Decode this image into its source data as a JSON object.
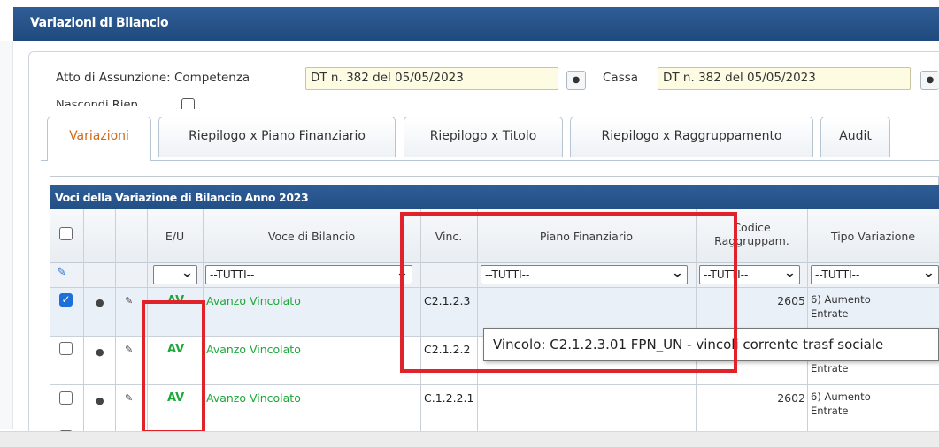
{
  "window": {
    "title": "Variazioni di Bilancio"
  },
  "header": {
    "atto_label": "Atto di Assunzione: Competenza",
    "competenza_value": "DT n. 382 del 05/05/2023",
    "cassa_label": "Cassa",
    "cassa_value": "DT n. 382 del 05/05/2023",
    "nascondi_label": "Nascondi Riep"
  },
  "tabs": [
    {
      "label": "Variazioni",
      "active": true
    },
    {
      "label": "Riepilogo x Piano Finanziario"
    },
    {
      "label": "Riepilogo x Titolo"
    },
    {
      "label": "Riepilogo x Raggruppamento"
    },
    {
      "label": "Audit"
    }
  ],
  "grid": {
    "title": "Voci della Variazione di Bilancio Anno 2023",
    "columns": {
      "eu": "E/U",
      "voce": "Voce di Bilancio",
      "vinc": "Vinc.",
      "piano": "Piano Finanziario",
      "codice": "Codice Raggruppam.",
      "tipo": "Tipo Variazione"
    },
    "filters": {
      "voce": "--TUTTI--",
      "piano": "--TUTTI--",
      "codice": "--TUTTI--",
      "tipo": "--TUTTI--"
    },
    "rows": [
      {
        "checked": true,
        "eu": "AV",
        "voce": "Avanzo Vincolato",
        "vinc": "C2.1.2.3",
        "codice": "2605",
        "tipo": "6) Aumento Entrate"
      },
      {
        "checked": false,
        "eu": "AV",
        "voce": "Avanzo Vincolato",
        "vinc": "C2.1.2.2",
        "codice": "",
        "tipo": "Entrate"
      },
      {
        "checked": false,
        "eu": "AV",
        "voce": "Avanzo Vincolato",
        "vinc": "C.1.2.2.1",
        "codice": "2602",
        "tipo": "6) Aumento Entrate"
      }
    ]
  },
  "tooltip": {
    "text": "Vincolo: C2.1.2.3.01 FPN_UN - vincoli corrente trasf sociale"
  },
  "icons": {
    "eye": "eye-icon",
    "edit": "pencil-icon",
    "chevron": "chevron-down-icon",
    "eraser": "eraser-icon"
  },
  "colors": {
    "header_blue": "#2f5d96",
    "active_tab_text": "#d06a17",
    "av_green": "#1ea83a",
    "field_yellow": "#fdfbe2",
    "highlight_red": "#e0222a"
  }
}
